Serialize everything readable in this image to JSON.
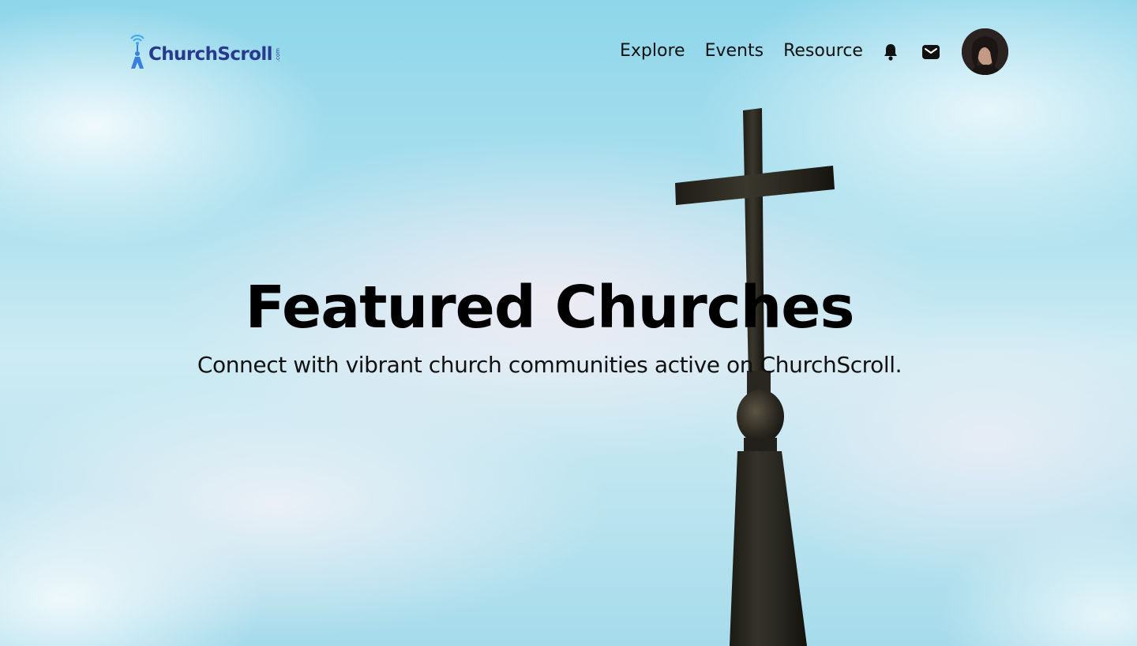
{
  "brand": {
    "name": "ChurchScroll",
    "tld": ".com",
    "color": "#273a8c",
    "accent": "#3ea8f0"
  },
  "nav": {
    "links": [
      "Explore",
      "Events",
      "Resource"
    ],
    "icons": [
      "bell-icon",
      "mail-icon"
    ]
  },
  "hero": {
    "title": "Featured Churches",
    "subtitle": "Connect with vibrant church communities active on ChurchScroll."
  }
}
